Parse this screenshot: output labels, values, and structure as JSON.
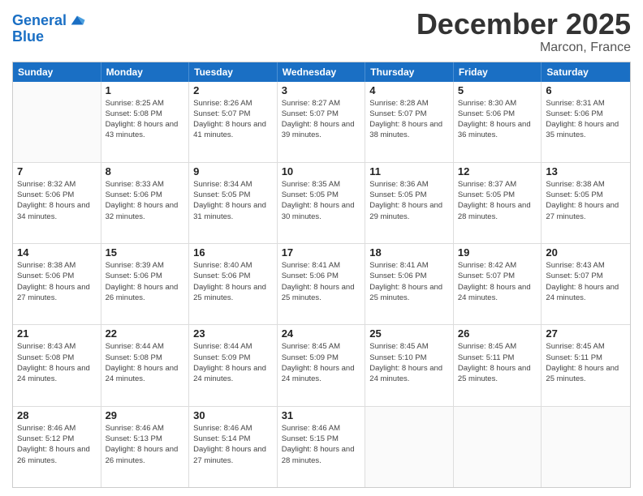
{
  "header": {
    "logo_line1": "General",
    "logo_line2": "Blue",
    "month": "December 2025",
    "location": "Marcon, France"
  },
  "weekdays": [
    "Sunday",
    "Monday",
    "Tuesday",
    "Wednesday",
    "Thursday",
    "Friday",
    "Saturday"
  ],
  "rows": [
    [
      {
        "day": "",
        "empty": true
      },
      {
        "day": "1",
        "sunrise": "Sunrise: 8:25 AM",
        "sunset": "Sunset: 5:08 PM",
        "daylight": "Daylight: 8 hours and 43 minutes."
      },
      {
        "day": "2",
        "sunrise": "Sunrise: 8:26 AM",
        "sunset": "Sunset: 5:07 PM",
        "daylight": "Daylight: 8 hours and 41 minutes."
      },
      {
        "day": "3",
        "sunrise": "Sunrise: 8:27 AM",
        "sunset": "Sunset: 5:07 PM",
        "daylight": "Daylight: 8 hours and 39 minutes."
      },
      {
        "day": "4",
        "sunrise": "Sunrise: 8:28 AM",
        "sunset": "Sunset: 5:07 PM",
        "daylight": "Daylight: 8 hours and 38 minutes."
      },
      {
        "day": "5",
        "sunrise": "Sunrise: 8:30 AM",
        "sunset": "Sunset: 5:06 PM",
        "daylight": "Daylight: 8 hours and 36 minutes."
      },
      {
        "day": "6",
        "sunrise": "Sunrise: 8:31 AM",
        "sunset": "Sunset: 5:06 PM",
        "daylight": "Daylight: 8 hours and 35 minutes."
      }
    ],
    [
      {
        "day": "7",
        "sunrise": "Sunrise: 8:32 AM",
        "sunset": "Sunset: 5:06 PM",
        "daylight": "Daylight: 8 hours and 34 minutes."
      },
      {
        "day": "8",
        "sunrise": "Sunrise: 8:33 AM",
        "sunset": "Sunset: 5:06 PM",
        "daylight": "Daylight: 8 hours and 32 minutes."
      },
      {
        "day": "9",
        "sunrise": "Sunrise: 8:34 AM",
        "sunset": "Sunset: 5:05 PM",
        "daylight": "Daylight: 8 hours and 31 minutes."
      },
      {
        "day": "10",
        "sunrise": "Sunrise: 8:35 AM",
        "sunset": "Sunset: 5:05 PM",
        "daylight": "Daylight: 8 hours and 30 minutes."
      },
      {
        "day": "11",
        "sunrise": "Sunrise: 8:36 AM",
        "sunset": "Sunset: 5:05 PM",
        "daylight": "Daylight: 8 hours and 29 minutes."
      },
      {
        "day": "12",
        "sunrise": "Sunrise: 8:37 AM",
        "sunset": "Sunset: 5:05 PM",
        "daylight": "Daylight: 8 hours and 28 minutes."
      },
      {
        "day": "13",
        "sunrise": "Sunrise: 8:38 AM",
        "sunset": "Sunset: 5:05 PM",
        "daylight": "Daylight: 8 hours and 27 minutes."
      }
    ],
    [
      {
        "day": "14",
        "sunrise": "Sunrise: 8:38 AM",
        "sunset": "Sunset: 5:06 PM",
        "daylight": "Daylight: 8 hours and 27 minutes."
      },
      {
        "day": "15",
        "sunrise": "Sunrise: 8:39 AM",
        "sunset": "Sunset: 5:06 PM",
        "daylight": "Daylight: 8 hours and 26 minutes."
      },
      {
        "day": "16",
        "sunrise": "Sunrise: 8:40 AM",
        "sunset": "Sunset: 5:06 PM",
        "daylight": "Daylight: 8 hours and 25 minutes."
      },
      {
        "day": "17",
        "sunrise": "Sunrise: 8:41 AM",
        "sunset": "Sunset: 5:06 PM",
        "daylight": "Daylight: 8 hours and 25 minutes."
      },
      {
        "day": "18",
        "sunrise": "Sunrise: 8:41 AM",
        "sunset": "Sunset: 5:06 PM",
        "daylight": "Daylight: 8 hours and 25 minutes."
      },
      {
        "day": "19",
        "sunrise": "Sunrise: 8:42 AM",
        "sunset": "Sunset: 5:07 PM",
        "daylight": "Daylight: 8 hours and 24 minutes."
      },
      {
        "day": "20",
        "sunrise": "Sunrise: 8:43 AM",
        "sunset": "Sunset: 5:07 PM",
        "daylight": "Daylight: 8 hours and 24 minutes."
      }
    ],
    [
      {
        "day": "21",
        "sunrise": "Sunrise: 8:43 AM",
        "sunset": "Sunset: 5:08 PM",
        "daylight": "Daylight: 8 hours and 24 minutes."
      },
      {
        "day": "22",
        "sunrise": "Sunrise: 8:44 AM",
        "sunset": "Sunset: 5:08 PM",
        "daylight": "Daylight: 8 hours and 24 minutes."
      },
      {
        "day": "23",
        "sunrise": "Sunrise: 8:44 AM",
        "sunset": "Sunset: 5:09 PM",
        "daylight": "Daylight: 8 hours and 24 minutes."
      },
      {
        "day": "24",
        "sunrise": "Sunrise: 8:45 AM",
        "sunset": "Sunset: 5:09 PM",
        "daylight": "Daylight: 8 hours and 24 minutes."
      },
      {
        "day": "25",
        "sunrise": "Sunrise: 8:45 AM",
        "sunset": "Sunset: 5:10 PM",
        "daylight": "Daylight: 8 hours and 24 minutes."
      },
      {
        "day": "26",
        "sunrise": "Sunrise: 8:45 AM",
        "sunset": "Sunset: 5:11 PM",
        "daylight": "Daylight: 8 hours and 25 minutes."
      },
      {
        "day": "27",
        "sunrise": "Sunrise: 8:45 AM",
        "sunset": "Sunset: 5:11 PM",
        "daylight": "Daylight: 8 hours and 25 minutes."
      }
    ],
    [
      {
        "day": "28",
        "sunrise": "Sunrise: 8:46 AM",
        "sunset": "Sunset: 5:12 PM",
        "daylight": "Daylight: 8 hours and 26 minutes."
      },
      {
        "day": "29",
        "sunrise": "Sunrise: 8:46 AM",
        "sunset": "Sunset: 5:13 PM",
        "daylight": "Daylight: 8 hours and 26 minutes."
      },
      {
        "day": "30",
        "sunrise": "Sunrise: 8:46 AM",
        "sunset": "Sunset: 5:14 PM",
        "daylight": "Daylight: 8 hours and 27 minutes."
      },
      {
        "day": "31",
        "sunrise": "Sunrise: 8:46 AM",
        "sunset": "Sunset: 5:15 PM",
        "daylight": "Daylight: 8 hours and 28 minutes."
      },
      {
        "day": "",
        "empty": true
      },
      {
        "day": "",
        "empty": true
      },
      {
        "day": "",
        "empty": true
      }
    ]
  ]
}
